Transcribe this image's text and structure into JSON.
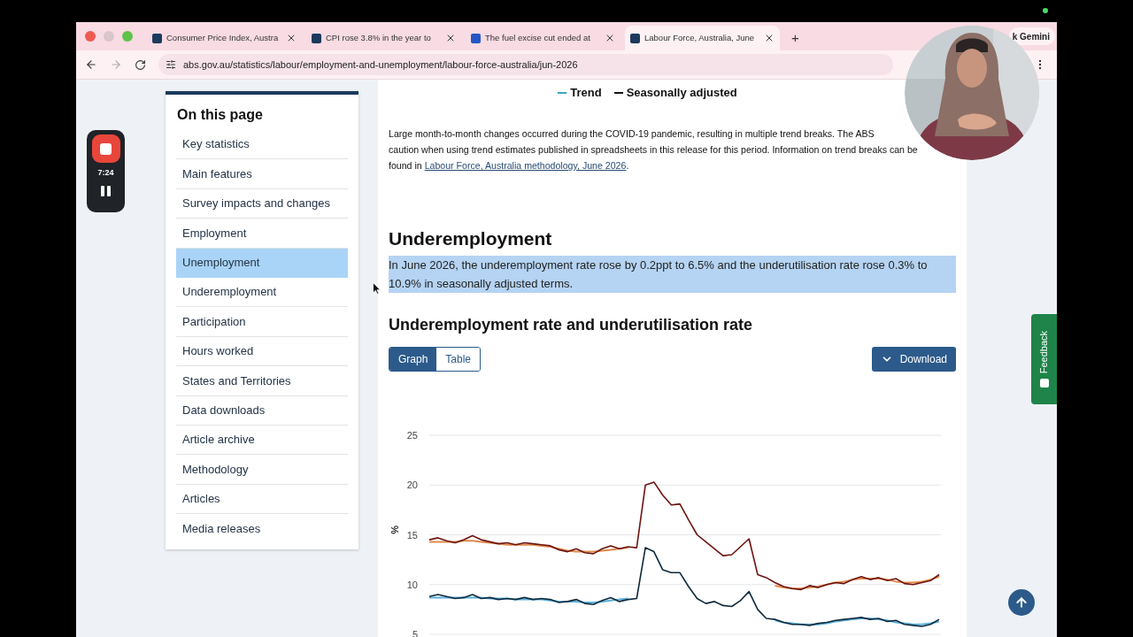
{
  "browser": {
    "tabs": [
      {
        "title": "Consumer Price Index, Austra",
        "color": "#1b3a5c",
        "selected": false
      },
      {
        "title": "CPI rose 3.8% in the year to",
        "color": "#1b3a5c",
        "selected": false
      },
      {
        "title": "The fuel excise cut ended at",
        "color": "#2457c5",
        "selected": false
      },
      {
        "title": "Labour Force, Australia, June",
        "color": "#1b3a5c",
        "selected": true
      }
    ],
    "new_tab": "+",
    "url": "abs.gov.au/statistics/labour/employment-and-unemployment/labour-force-australia/jun-2026",
    "ask_button": "k Gemini"
  },
  "recorder": {
    "time": "7:24"
  },
  "sidebar": {
    "title": "On this page",
    "items": [
      {
        "label": "Key statistics",
        "selected": false
      },
      {
        "label": "Main features",
        "selected": false
      },
      {
        "label": "Survey impacts and changes",
        "selected": false
      },
      {
        "label": "Employment",
        "selected": false
      },
      {
        "label": "Unemployment",
        "selected": true
      },
      {
        "label": "Underemployment",
        "selected": false
      },
      {
        "label": "Participation",
        "selected": false
      },
      {
        "label": "Hours worked",
        "selected": false
      },
      {
        "label": "States and Territories",
        "selected": false
      },
      {
        "label": "Data downloads",
        "selected": false
      },
      {
        "label": "Article archive",
        "selected": false
      },
      {
        "label": "Methodology",
        "selected": false
      },
      {
        "label": "Articles",
        "selected": false
      },
      {
        "label": "Media releases",
        "selected": false
      }
    ]
  },
  "main": {
    "legend": [
      {
        "label": "Trend",
        "color": "#3aa5c9"
      },
      {
        "label": "Seasonally adjusted",
        "color": "#111111"
      }
    ],
    "note": {
      "lines": [
        "Large month-to-month changes occurred during the COVID-19 pandemic, resulting in multiple trend breaks. The ABS",
        "caution when using trend estimates published in spreadsheets in this release for this period. Information on trend breaks can be",
        "found in "
      ],
      "link": "Labour Force, Australia methodology, June 2026",
      "tail": "."
    },
    "heading": "Underemployment",
    "summary": {
      "text": "In June 2026, the underemployment rate rose by 0.2ppt to 6.5% and the underutilisation rate rose 0.3% to 10.9% in seasonally adjusted terms.",
      "highlighted": true
    },
    "chart_title": "Underemployment rate and underutilisation rate",
    "view_tabs": [
      {
        "label": "Graph",
        "selected": true
      },
      {
        "label": "Table",
        "selected": false
      }
    ],
    "download": "Download",
    "chart_data": {
      "type": "line",
      "grid": true,
      "ylabel": "%",
      "ylim": [
        5,
        25
      ],
      "yticks": [
        5,
        10,
        15,
        20,
        25
      ],
      "series": [
        {
          "color": "#e08a4a",
          "values": [
            14.3,
            14.3,
            14.3,
            14.3,
            14.4,
            14.4,
            14.3,
            14.2,
            14.1,
            14.0,
            14.0,
            14.0,
            14.0,
            13.9,
            13.8,
            13.6,
            13.4,
            13.3,
            13.3,
            13.3,
            13.4,
            13.5,
            13.6,
            13.7,
            null,
            null,
            null,
            null,
            null,
            null,
            null,
            null,
            null,
            null,
            null,
            null,
            null,
            null,
            null,
            null,
            9.9,
            9.7,
            9.6,
            9.6,
            9.7,
            9.8,
            10.0,
            10.2,
            10.3,
            10.5,
            10.6,
            10.6,
            10.6,
            10.5,
            10.3,
            10.2,
            10.2,
            10.3,
            10.5,
            10.8
          ]
        },
        {
          "color": "#5bb0dc",
          "values": [
            8.7,
            8.7,
            8.7,
            8.7,
            8.7,
            8.7,
            8.7,
            8.6,
            8.6,
            8.6,
            8.5,
            8.5,
            8.5,
            8.5,
            8.4,
            8.3,
            8.3,
            8.3,
            8.2,
            8.2,
            8.3,
            8.4,
            8.5,
            8.6,
            null,
            null,
            null,
            null,
            null,
            null,
            null,
            null,
            null,
            null,
            null,
            null,
            null,
            null,
            null,
            null,
            6.4,
            6.2,
            6.1,
            6.0,
            6.0,
            6.0,
            6.1,
            6.3,
            6.4,
            6.5,
            6.6,
            6.6,
            6.5,
            6.4,
            6.2,
            6.1,
            6.0,
            6.0,
            6.1,
            6.3
          ]
        },
        {
          "color": "#6e1410",
          "values": [
            14.5,
            14.7,
            14.4,
            14.2,
            14.5,
            14.9,
            14.5,
            14.3,
            14.1,
            14.2,
            14.0,
            14.2,
            14.1,
            14.0,
            13.9,
            13.5,
            13.3,
            13.6,
            13.2,
            13.1,
            13.6,
            13.9,
            13.6,
            13.8,
            13.7,
            20.0,
            20.3,
            19.0,
            18.0,
            18.1,
            16.5,
            15.0,
            14.3,
            13.6,
            12.9,
            13.0,
            13.8,
            14.6,
            11.0,
            10.7,
            10.2,
            9.8,
            9.6,
            9.5,
            9.9,
            9.7,
            10.0,
            10.2,
            10.1,
            10.5,
            10.8,
            10.5,
            10.7,
            10.4,
            10.6,
            10.1,
            10.0,
            10.2,
            10.4,
            11.0
          ]
        },
        {
          "color": "#0f2a3d",
          "values": [
            8.8,
            9.0,
            8.8,
            8.6,
            8.7,
            9.0,
            8.6,
            8.7,
            8.5,
            8.6,
            8.5,
            8.7,
            8.5,
            8.6,
            8.5,
            8.2,
            8.3,
            8.5,
            8.1,
            8.0,
            8.4,
            8.7,
            8.3,
            8.5,
            8.6,
            13.7,
            13.3,
            11.5,
            11.2,
            11.2,
            9.8,
            8.6,
            8.1,
            8.3,
            7.9,
            7.8,
            8.4,
            9.3,
            7.5,
            6.6,
            6.5,
            6.2,
            6.0,
            6.0,
            5.9,
            6.1,
            6.2,
            6.4,
            6.5,
            6.6,
            6.7,
            6.5,
            6.6,
            6.3,
            6.4,
            6.0,
            5.9,
            5.8,
            6.0,
            6.5
          ]
        }
      ]
    }
  },
  "feedback": "Feedback"
}
